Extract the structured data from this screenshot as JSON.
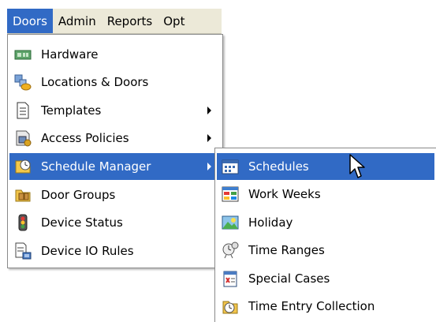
{
  "menubar": {
    "items": [
      {
        "label": "Doors",
        "active": true
      },
      {
        "label": "Admin"
      },
      {
        "label": "Reports"
      },
      {
        "label": "Opt"
      }
    ]
  },
  "doors_menu": {
    "items": [
      {
        "label": "Hardware",
        "icon": "hardware-icon"
      },
      {
        "label": "Locations & Doors",
        "icon": "locations-doors-icon"
      },
      {
        "label": "Templates",
        "icon": "templates-icon",
        "submenu": true
      },
      {
        "label": "Access Policies",
        "icon": "access-policies-icon",
        "submenu": true
      },
      {
        "label": "Schedule Manager",
        "icon": "schedule-manager-icon",
        "submenu": true,
        "highlighted": true
      },
      {
        "label": "Door Groups",
        "icon": "door-groups-icon"
      },
      {
        "label": "Device Status",
        "icon": "device-status-icon"
      },
      {
        "label": "Device IO Rules",
        "icon": "device-io-rules-icon"
      }
    ]
  },
  "schedule_submenu": {
    "items": [
      {
        "label": "Schedules",
        "icon": "schedules-icon",
        "highlighted": true
      },
      {
        "label": "Work Weeks",
        "icon": "work-weeks-icon"
      },
      {
        "label": "Holiday",
        "icon": "holiday-icon"
      },
      {
        "label": "Time Ranges",
        "icon": "time-ranges-icon"
      },
      {
        "label": "Special Cases",
        "icon": "special-cases-icon"
      },
      {
        "label": "Time Entry Collection",
        "icon": "time-entry-collection-icon"
      }
    ]
  },
  "colors": {
    "highlight": "#316ac5",
    "menubar_bg": "#ece9d8",
    "menu_bg": "#ffffff"
  }
}
